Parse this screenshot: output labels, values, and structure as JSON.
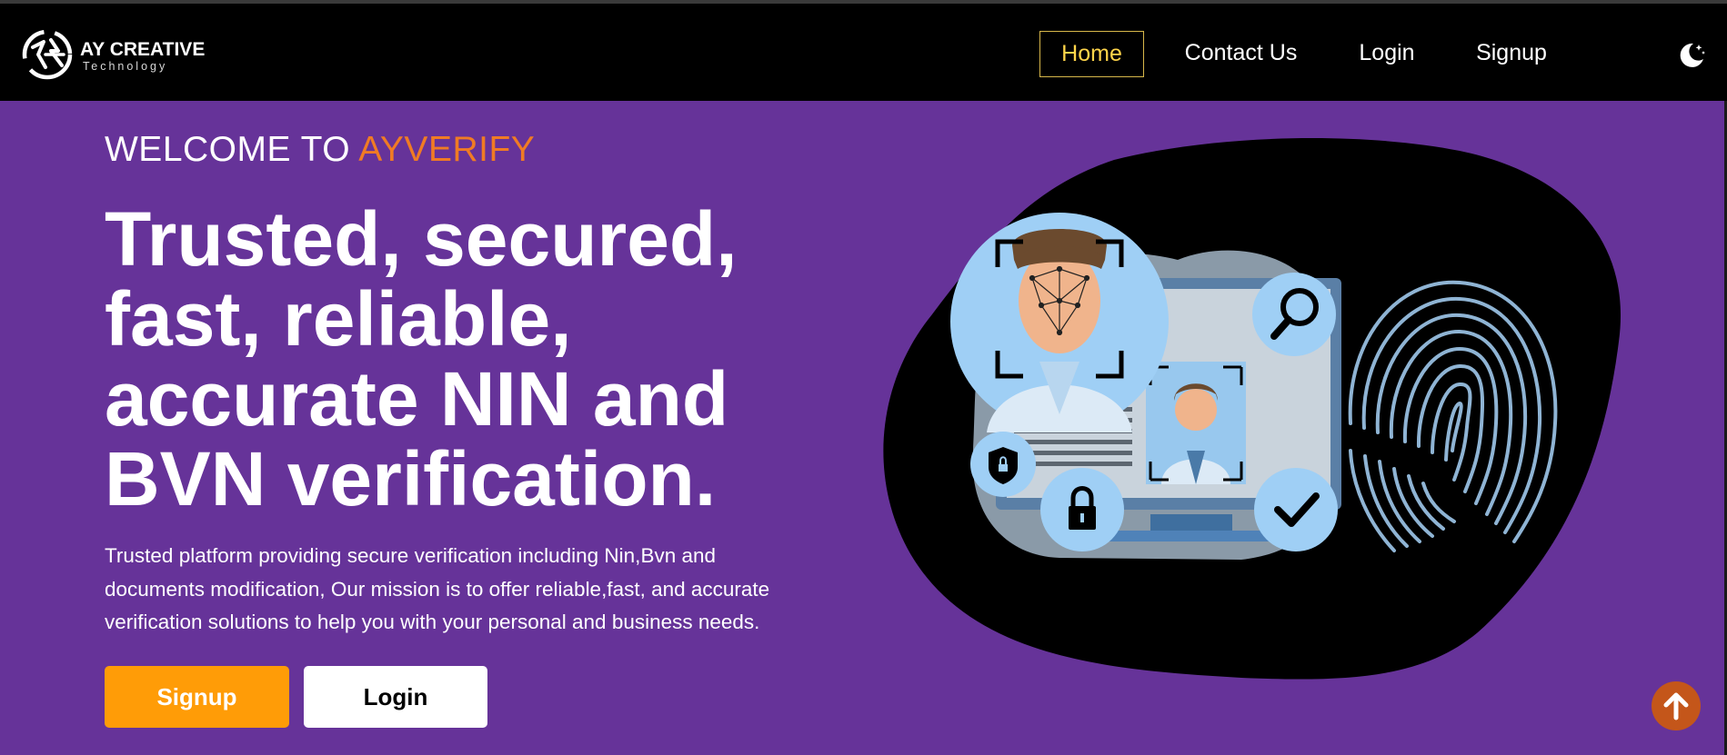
{
  "brand": {
    "name": "AY CREATIVE",
    "tagline": "Technology"
  },
  "nav": {
    "items": [
      {
        "label": "Home",
        "active": true
      },
      {
        "label": "Contact Us",
        "active": false
      },
      {
        "label": "Login",
        "active": false
      },
      {
        "label": "Signup",
        "active": false
      }
    ],
    "theme_toggle_icon": "moon-stars-icon"
  },
  "hero": {
    "welcome_prefix": "WELCOME TO",
    "welcome_brand": "AYVERIFY",
    "headline_lines": [
      "Trusted, secured,",
      "fast, reliable,",
      "accurate NIN and",
      "BVN verification."
    ],
    "description_lines": [
      "Trusted platform providing secure verification including Nin,Bvn and",
      "documents modification, Our mission is to offer reliable,fast, and accurate",
      "verification solutions to help you with your personal and business needs."
    ],
    "signup_button": "Signup",
    "login_button": "Login"
  },
  "illustration": {
    "icons": [
      "face-scan-icon",
      "search-icon",
      "id-card-icon",
      "shield-icon",
      "lock-icon",
      "checkmark-icon",
      "fingerprint-icon"
    ]
  },
  "scroll_top_icon": "arrow-up-icon",
  "colors": {
    "nav_bg": "#000000",
    "hero_bg": "#663399",
    "accent_orange": "#f07b24",
    "signup_bg": "#ff9c07",
    "active_nav": "#ffd54a",
    "scroll_btn": "#c4561a"
  }
}
